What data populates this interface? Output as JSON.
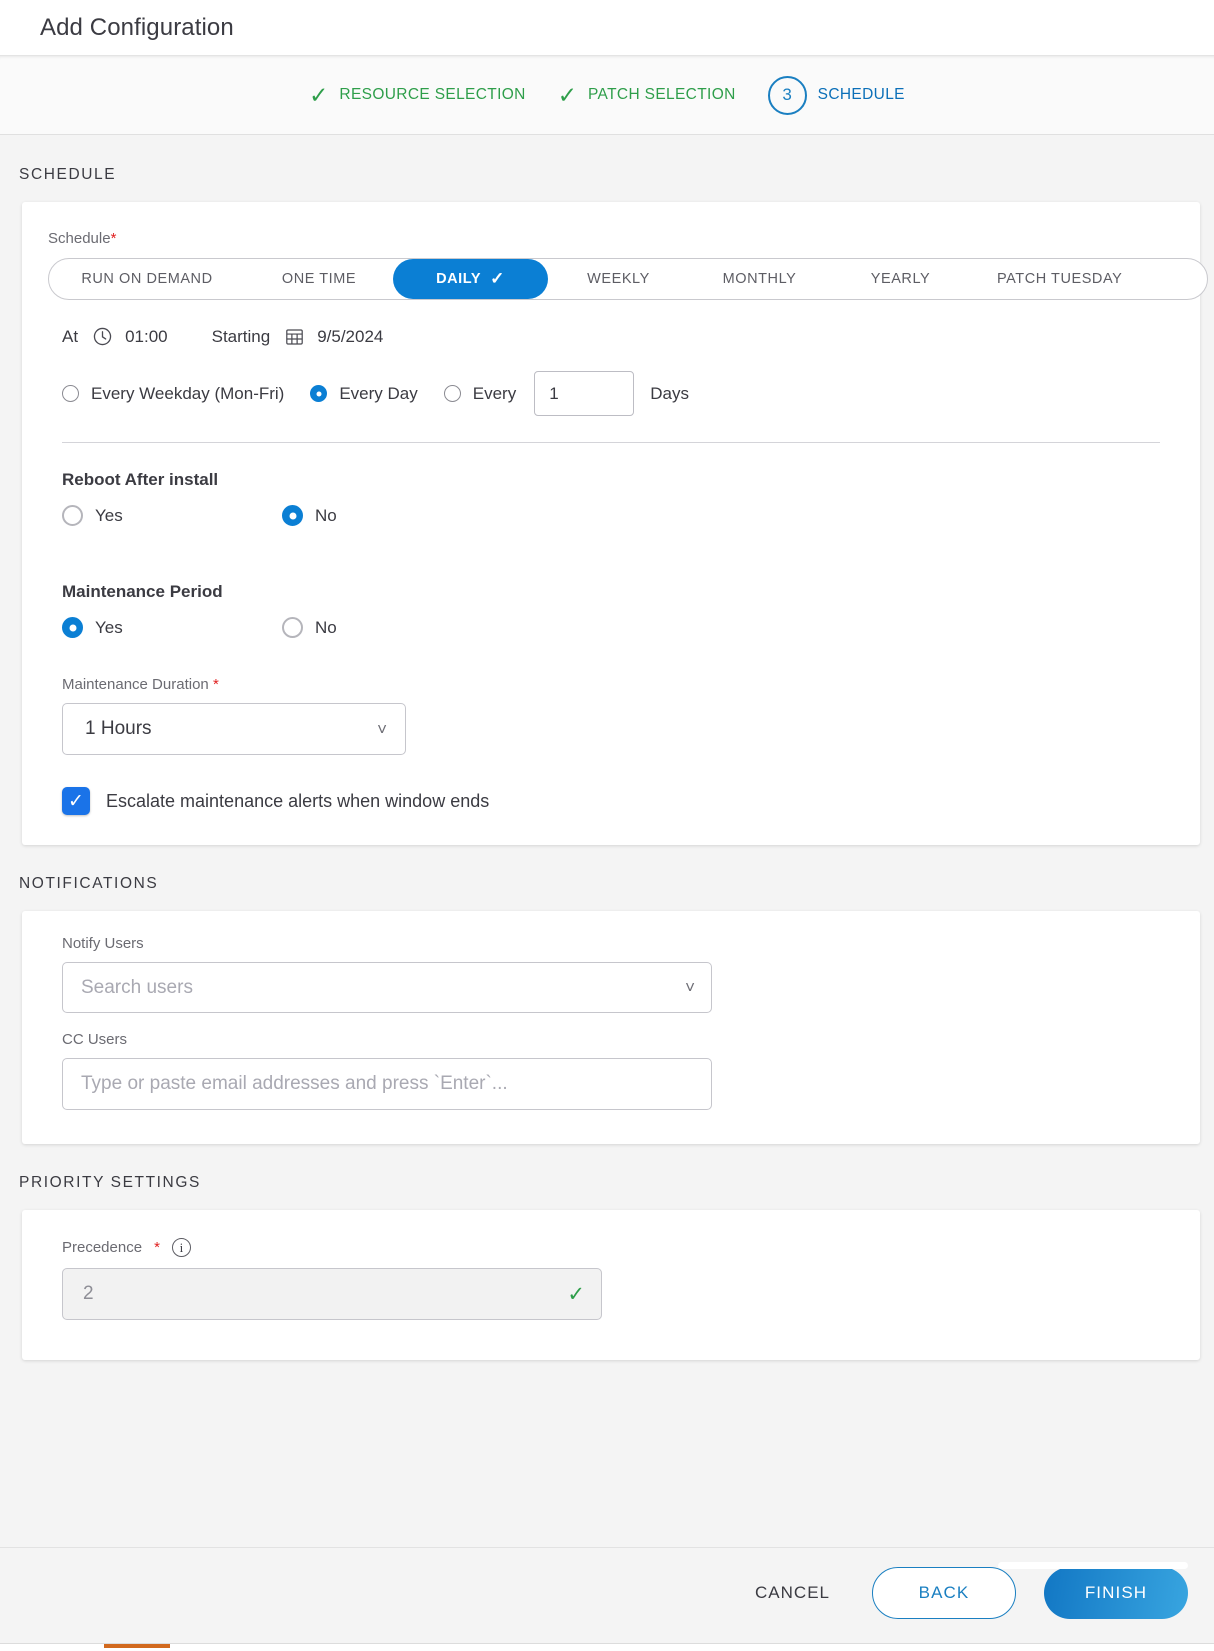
{
  "window": {
    "title": "Add Configuration"
  },
  "wizard": {
    "steps": [
      {
        "label": "RESOURCE SELECTION",
        "state": "done",
        "marker": "check"
      },
      {
        "label": "PATCH SELECTION",
        "state": "done",
        "marker": "check"
      },
      {
        "label": "SCHEDULE",
        "state": "active",
        "marker": "3"
      }
    ]
  },
  "schedule": {
    "section_title": "SCHEDULE",
    "field_label": "Schedule",
    "required_mark": "*",
    "tabs": [
      {
        "label": "RUN ON DEMAND",
        "selected": false
      },
      {
        "label": "ONE TIME",
        "selected": false
      },
      {
        "label": "DAILY",
        "selected": true
      },
      {
        "label": "WEEKLY",
        "selected": false
      },
      {
        "label": "MONTHLY",
        "selected": false
      },
      {
        "label": "YEARLY",
        "selected": false
      },
      {
        "label": "PATCH TUESDAY",
        "selected": false
      }
    ],
    "at_label": "At",
    "at_value": "01:00",
    "starting_label": "Starting",
    "starting_value": "9/5/2024",
    "recurrence": {
      "weekday_label": "Every Weekday (Mon-Fri)",
      "weekday_selected": false,
      "everyday_label": "Every Day",
      "everyday_selected": true,
      "every_label": "Every",
      "every_selected": false,
      "every_value": "1",
      "days_label": "Days"
    },
    "reboot": {
      "title": "Reboot After install",
      "yes_label": "Yes",
      "no_label": "No",
      "selected": "No"
    },
    "maintenance": {
      "title": "Maintenance Period",
      "yes_label": "Yes",
      "no_label": "No",
      "selected": "Yes",
      "duration_label": "Maintenance Duration",
      "duration_required": "*",
      "duration_value": "1 Hours",
      "escalate_label": "Escalate maintenance alerts when window ends",
      "escalate_checked": true
    }
  },
  "notifications": {
    "section_title": "NOTIFICATIONS",
    "notify_users_label": "Notify Users",
    "notify_users_placeholder": "Search users",
    "cc_users_label": "CC Users",
    "cc_users_placeholder": "Type or paste email addresses and press `Enter`..."
  },
  "priority": {
    "section_title": "PRIORITY SETTINGS",
    "precedence_label": "Precedence",
    "precedence_required": "*",
    "precedence_value": "2"
  },
  "footer": {
    "cancel_label": "CANCEL",
    "back_label": "BACK",
    "finish_label": "FINISH"
  },
  "colors": {
    "accent": "#0b7fd4",
    "done": "#2e9e4a",
    "active": "#0b6fb8",
    "required": "#e02020"
  }
}
